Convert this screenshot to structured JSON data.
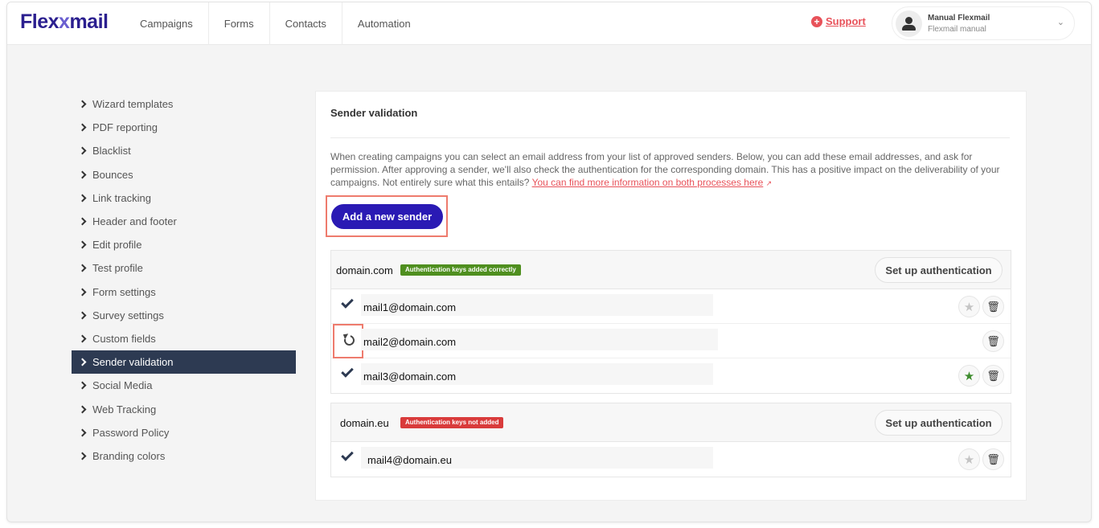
{
  "brand": {
    "logo_pre": "Flex",
    "logo_x": "x",
    "logo_post": "mail"
  },
  "nav": [
    "Campaigns",
    "Forms",
    "Contacts",
    "Automation"
  ],
  "support": {
    "label": "Support",
    "color": "#e8525a"
  },
  "user": {
    "name": "Manual Flexmail",
    "subtitle": "Flexmail manual"
  },
  "sidebar": {
    "items": [
      "Wizard templates",
      "PDF reporting",
      "Blacklist",
      "Bounces",
      "Link tracking",
      "Header and footer",
      "Edit profile",
      "Test profile",
      "Form settings",
      "Survey settings",
      "Custom fields",
      "Sender validation",
      "Social Media",
      "Web Tracking",
      "Password Policy",
      "Branding colors"
    ],
    "active": "Sender validation"
  },
  "main": {
    "title": "Sender validation",
    "description": "When creating campaigns you can select an email address from your list of approved senders. Below, you can add these email addresses, and ask for permission. After approving a sender, we'll also check the authentication for the corresponding domain. This has a positive impact on the deliverability of your campaigns. Not entirely sure what this entails? ",
    "info_link": "You can find more information on both processes here",
    "add_button": "Add a new sender",
    "auth_button": "Set up authentication",
    "accent_color": "#2a1ab4",
    "domains": [
      {
        "name": "domain.com",
        "badge": "Authentication keys added correctly",
        "badge_color": "#4f8f1f",
        "senders": [
          {
            "email": "mail1@domain.com",
            "status": "approved",
            "favorite": false
          },
          {
            "email": "mail2@domain.com",
            "status": "pending",
            "favorite": null
          },
          {
            "email": "mail3@domain.com",
            "status": "approved",
            "favorite": true
          }
        ]
      },
      {
        "name": "domain.eu",
        "badge": "Authentication keys not added",
        "badge_color": "#d93b3b",
        "senders": [
          {
            "email": "mail4@domain.eu",
            "status": "approved",
            "favorite": false
          }
        ]
      }
    ]
  }
}
